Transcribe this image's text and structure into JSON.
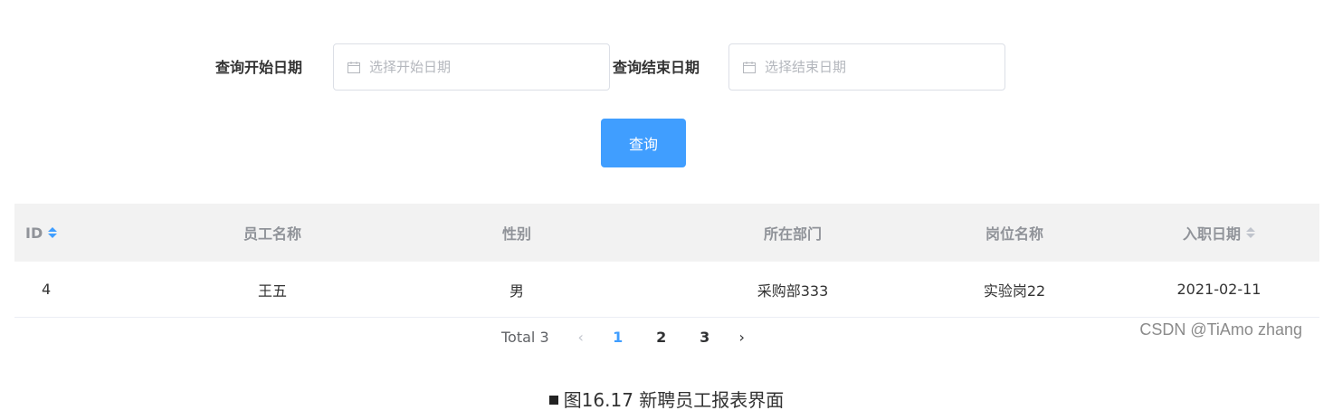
{
  "form": {
    "start_label": "查询开始日期",
    "start_placeholder": "选择开始日期",
    "end_label": "查询结束日期",
    "end_placeholder": "选择结束日期",
    "query_button": "查询"
  },
  "table": {
    "columns": [
      "ID",
      "员工名称",
      "性别",
      "所在部门",
      "岗位名称",
      "入职日期"
    ],
    "rows": [
      [
        "4",
        "王五",
        "男",
        "采购部333",
        "实验岗22",
        "2021-02-11"
      ]
    ]
  },
  "pagination": {
    "total": "Total 3",
    "prev": "‹",
    "next": "›",
    "pages": [
      "1",
      "2",
      "3"
    ],
    "current_page": "1"
  },
  "watermark": "CSDN @TiAmo zhang",
  "caption": "图16.17 新聘员工报表界面",
  "colors": {
    "primary": "#409eff",
    "header_bg": "#f2f2f2"
  }
}
